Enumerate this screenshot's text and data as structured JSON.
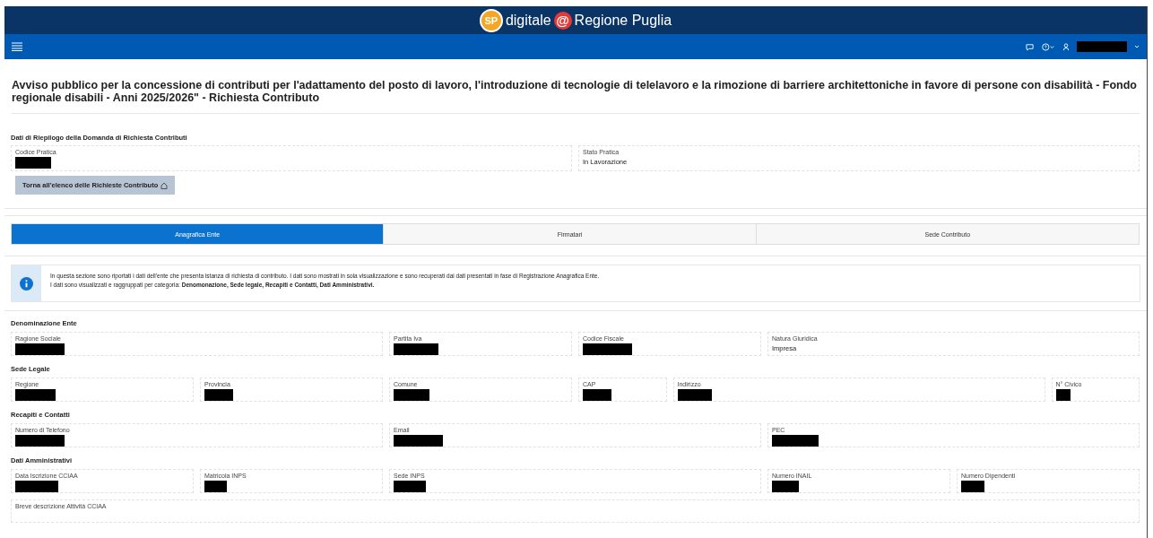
{
  "header": {
    "logo_mark": "SP",
    "brand_left": "digitale",
    "brand_at": "@",
    "brand_right": "Regione Puglia"
  },
  "navbar": {
    "user": {
      "redacted": true
    }
  },
  "page_title": "Avviso pubblico per la concessione di contributi per l'adattamento del posto di lavoro, l'introduzione di tecnologie di telelavoro e la rimozione di barriere architettoniche in favore di persone con disabilità - Fondo regionale disabili - Anni 2025/2026\" - Richiesta Contributo",
  "summary": {
    "heading": "Dati di Riepilogo della Domanda di Richiesta Contributi",
    "fields": [
      {
        "label": "Codice Pratica",
        "redacted": true
      },
      {
        "label": "Stato Pratica",
        "value": "In Lavorazione",
        "redacted": false
      }
    ],
    "back_button": "Torna all'elenco delle Richieste Contributo"
  },
  "tabs": [
    {
      "label": "Anagrafica Ente",
      "selected": true
    },
    {
      "label": "Firmatari",
      "selected": false
    },
    {
      "label": "Sede Contributo",
      "selected": false
    }
  ],
  "info": {
    "lines": [
      "In questa sezione sono riportati i dati dell'ente che presenta istanza di richiesta di contributo. I dati sono mostrati in sola visualizzazione e sono recuperati dai dati presentati in fase di Registrazione Anagrafica Ente.",
      "I dati sono visualizzati e raggruppati per categoria: **Denomonazione, Sede legale, Recapiti e Contatti, Dati Amministrativi.**"
    ]
  },
  "sections": [
    {
      "heading": "Denominazione Ente",
      "fields": [
        {
          "label": "Ragione Sociale",
          "redacted": true
        },
        {
          "label": "Partita Iva",
          "redacted": true
        },
        {
          "label": "Codice Fiscale",
          "redacted": true
        },
        {
          "label": "Natura Giuridica",
          "value": "Impresa",
          "redacted": false
        }
      ]
    },
    {
      "heading": "Sede Legale",
      "fields": [
        {
          "label": "Regione",
          "redacted": true
        },
        {
          "label": "Provincia",
          "redacted": true
        },
        {
          "label": "Comune",
          "redacted": true
        },
        {
          "label": "CAP",
          "redacted": true
        },
        {
          "label": "Indirizzo",
          "redacted": true
        },
        {
          "label": "N° Civico",
          "redacted": true
        }
      ]
    },
    {
      "heading": "Recapiti e Contatti",
      "fields": [
        {
          "label": "Numero di Telefono",
          "redacted": true
        },
        {
          "label": "Email",
          "redacted": true
        },
        {
          "label": "PEC",
          "redacted": true
        }
      ]
    },
    {
      "heading": "Dati Amministrativi",
      "fields": [
        {
          "label": "Data Iscrizione CCIAA",
          "redacted": true
        },
        {
          "label": "Matricola INPS",
          "redacted": true
        },
        {
          "label": "Sede INPS",
          "redacted": true
        },
        {
          "label": "Numero INAIL",
          "redacted": true
        },
        {
          "label": "Numero Dipendenti",
          "redacted": true
        },
        {
          "label": "Breve descrizione Attività CCIAA",
          "redacted": false
        }
      ]
    }
  ]
}
